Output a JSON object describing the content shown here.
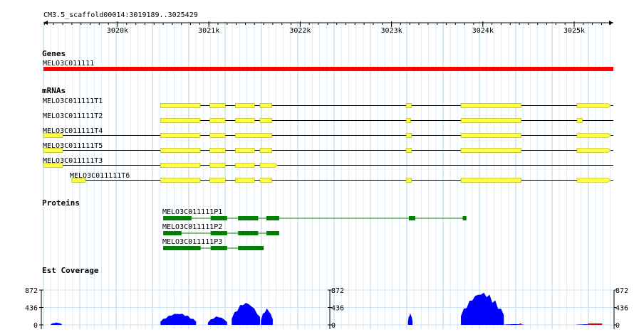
{
  "ruler": {
    "title": "CM3.5_scaffold00014:3019189..3025429",
    "start": 3019189,
    "end": 3025429,
    "ticks": [
      "3020k",
      "3021k",
      "3022k",
      "3023k",
      "3024k",
      "3025k"
    ]
  },
  "tracks": {
    "genes": {
      "title": "Genes",
      "features": [
        {
          "name": "MELO3C011111",
          "start": 3019189,
          "end": 3025429,
          "color": "#ff0000"
        }
      ]
    },
    "mrnas": {
      "title": "mRNAs",
      "color": "#ffff44",
      "items": [
        {
          "name": "MELO3C011111T1",
          "exons": [
            [
              3020470,
              3020905
            ],
            [
              3021010,
              3021180
            ],
            [
              3021290,
              3021500
            ],
            [
              3021560,
              3021690
            ],
            [
              3023160,
              3023220
            ],
            [
              3023760,
              3024420
            ],
            [
              3025030,
              3025400
            ]
          ],
          "arrow": true
        },
        {
          "name": "MELO3C011111T2",
          "exons": [
            [
              3020470,
              3020905
            ],
            [
              3021010,
              3021180
            ],
            [
              3021290,
              3021500
            ],
            [
              3021560,
              3021690
            ],
            [
              3023160,
              3023210
            ],
            [
              3023760,
              3024420
            ],
            [
              3025030,
              3025090
            ]
          ],
          "arrow": false
        },
        {
          "name": "MELO3C011111T4",
          "exons": [
            [
              3019189,
              3019400
            ],
            [
              3020470,
              3020905
            ],
            [
              3021010,
              3021180
            ],
            [
              3021290,
              3021690
            ],
            [
              3023160,
              3023220
            ],
            [
              3023760,
              3024420
            ],
            [
              3025030,
              3025400
            ]
          ],
          "arrow": true
        },
        {
          "name": "MELO3C011111T5",
          "exons": [
            [
              3019189,
              3019400
            ],
            [
              3020470,
              3020905
            ],
            [
              3021010,
              3021180
            ],
            [
              3021290,
              3021500
            ],
            [
              3021560,
              3021690
            ],
            [
              3023160,
              3023220
            ],
            [
              3023760,
              3024420
            ],
            [
              3025030,
              3025400
            ]
          ],
          "arrow": true
        },
        {
          "name": "MELO3C011111T3",
          "exons": [
            [
              3019189,
              3019400
            ],
            [
              3020470,
              3020905
            ],
            [
              3021010,
              3021180
            ],
            [
              3021290,
              3021500
            ],
            [
              3021560,
              3021750
            ]
          ],
          "arrow": true
        },
        {
          "name": "MELO3C011111T6",
          "exons": [
            [
              3019500,
              3019650
            ],
            [
              3020470,
              3020905
            ],
            [
              3021010,
              3021180
            ],
            [
              3021290,
              3021500
            ],
            [
              3021560,
              3021690
            ],
            [
              3023160,
              3023220
            ],
            [
              3023760,
              3024420
            ],
            [
              3025030,
              3025400
            ]
          ],
          "arrow": true
        }
      ]
    },
    "proteins": {
      "title": "Proteins",
      "color": "#008000",
      "items": [
        {
          "name": "MELO3C011111P1",
          "exons": [
            [
              3020500,
              3020810
            ],
            [
              3021020,
              3021200
            ],
            [
              3021320,
              3021540
            ],
            [
              3021630,
              3021770
            ],
            [
              3023190,
              3023260
            ],
            [
              3023780,
              3023820
            ]
          ]
        },
        {
          "name": "MELO3C011111P2",
          "exons": [
            [
              3020500,
              3020700
            ],
            [
              3021020,
              3021200
            ],
            [
              3021320,
              3021540
            ],
            [
              3021630,
              3021770
            ]
          ]
        },
        {
          "name": "MELO3C011111P3",
          "exons": [
            [
              3020500,
              3020910
            ],
            [
              3021020,
              3021200
            ],
            [
              3021320,
              3021600
            ]
          ]
        }
      ]
    },
    "est": {
      "title": "Est Coverage",
      "max": 872,
      "axis_labels": [
        "872",
        "436",
        "0"
      ],
      "color": "#0000ff",
      "peaks": [
        [
          3019270,
          3019390,
          60
        ],
        [
          3020470,
          3020860,
          300
        ],
        [
          3020990,
          3021200,
          220
        ],
        [
          3021250,
          3021560,
          580
        ],
        [
          3021570,
          3021700,
          420
        ],
        [
          3023180,
          3023230,
          300
        ],
        [
          3023760,
          3024230,
          840
        ],
        [
          3024230,
          3024450,
          20
        ],
        [
          3025020,
          3025250,
          15
        ]
      ]
    }
  }
}
